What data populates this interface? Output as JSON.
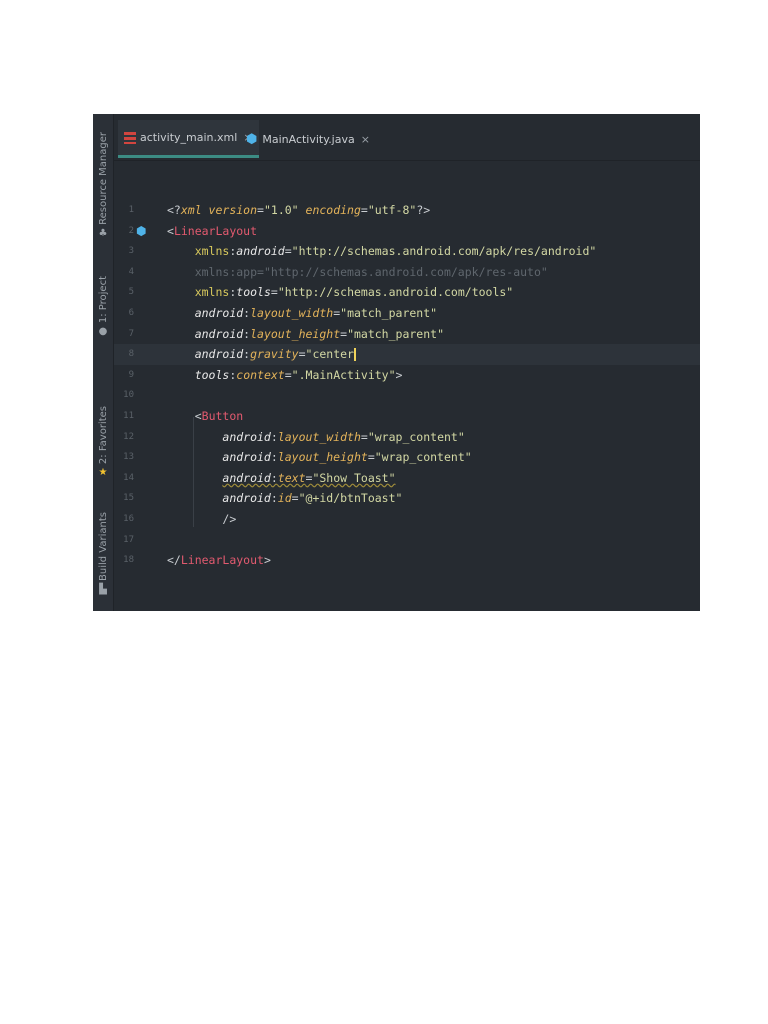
{
  "sidebar": {
    "items": [
      {
        "label": "Resource Manager",
        "icon": "resource-manager-icon"
      },
      {
        "label": "1: Project",
        "icon": "project-icon"
      },
      {
        "label": "2: Favorites",
        "icon": "star-icon"
      },
      {
        "label": "Build Variants",
        "icon": "build-variants-icon"
      }
    ]
  },
  "tabs": [
    {
      "label": "activity_main.xml",
      "close": "×",
      "icon": "xml-layout-icon"
    },
    {
      "label": "MainActivity.java",
      "close": "×",
      "icon": "java-class-icon"
    }
  ],
  "editor": {
    "current_line": 8,
    "lines": [
      {
        "n": "1",
        "tokens": [
          [
            "punct",
            "<?"
          ],
          [
            "decl",
            "xml version"
          ],
          [
            "punct",
            "="
          ],
          [
            "str",
            "\"1.0\" "
          ],
          [
            "decl",
            "encoding"
          ],
          [
            "punct",
            "="
          ],
          [
            "str",
            "\"utf-8\""
          ],
          [
            "punct",
            "?>"
          ]
        ]
      },
      {
        "n": "2",
        "tokens": [
          [
            "punct",
            "<"
          ],
          [
            "tag",
            "LinearLayout"
          ]
        ]
      },
      {
        "n": "3",
        "tokens": [
          [
            "pad",
            "    "
          ],
          [
            "xmlns",
            "xmlns"
          ],
          [
            "punct",
            ":"
          ],
          [
            "ns",
            "android"
          ],
          [
            "punct",
            "="
          ],
          [
            "str",
            "\"http://schemas.android.com/apk/res/android\""
          ]
        ]
      },
      {
        "n": "4",
        "tokens": [
          [
            "pad",
            "    "
          ],
          [
            "dim",
            "xmlns:app=\"http://schemas.android.com/apk/res-auto\""
          ]
        ]
      },
      {
        "n": "5",
        "tokens": [
          [
            "pad",
            "    "
          ],
          [
            "xmlns",
            "xmlns"
          ],
          [
            "punct",
            ":"
          ],
          [
            "ns",
            "tools"
          ],
          [
            "punct",
            "="
          ],
          [
            "str",
            "\"http://schemas.android.com/tools\""
          ]
        ]
      },
      {
        "n": "6",
        "tokens": [
          [
            "pad",
            "    "
          ],
          [
            "ns",
            "android"
          ],
          [
            "punct",
            ":"
          ],
          [
            "attr",
            "layout_width"
          ],
          [
            "punct",
            "="
          ],
          [
            "str",
            "\"match_parent\""
          ]
        ]
      },
      {
        "n": "7",
        "tokens": [
          [
            "pad",
            "    "
          ],
          [
            "ns",
            "android"
          ],
          [
            "punct",
            ":"
          ],
          [
            "attr",
            "layout_height"
          ],
          [
            "punct",
            "="
          ],
          [
            "str",
            "\"match_parent\""
          ]
        ]
      },
      {
        "n": "8",
        "tokens": [
          [
            "pad",
            "    "
          ],
          [
            "ns",
            "android"
          ],
          [
            "punct",
            ":"
          ],
          [
            "attr",
            "gravity"
          ],
          [
            "punct",
            "="
          ],
          [
            "str",
            "\"center"
          ],
          [
            "caret",
            ""
          ]
        ]
      },
      {
        "n": "9",
        "tokens": [
          [
            "pad",
            "    "
          ],
          [
            "ns",
            "tools"
          ],
          [
            "punct",
            ":"
          ],
          [
            "attr",
            "context"
          ],
          [
            "punct",
            "="
          ],
          [
            "str",
            "\".MainActivity\""
          ],
          [
            "punct",
            ">"
          ]
        ]
      },
      {
        "n": "10",
        "tokens": []
      },
      {
        "n": "11",
        "tokens": [
          [
            "pad",
            "    "
          ],
          [
            "punct",
            "<"
          ],
          [
            "tag",
            "Button"
          ]
        ]
      },
      {
        "n": "12",
        "tokens": [
          [
            "pad",
            "        "
          ],
          [
            "ns",
            "android"
          ],
          [
            "punct",
            ":"
          ],
          [
            "attr",
            "layout_width"
          ],
          [
            "punct",
            "="
          ],
          [
            "str",
            "\"wrap_content\""
          ]
        ]
      },
      {
        "n": "13",
        "tokens": [
          [
            "pad",
            "        "
          ],
          [
            "ns",
            "android"
          ],
          [
            "punct",
            ":"
          ],
          [
            "attr",
            "layout_height"
          ],
          [
            "punct",
            "="
          ],
          [
            "str",
            "\"wrap_content\""
          ]
        ]
      },
      {
        "n": "14",
        "tokens": [
          [
            "pad",
            "        "
          ],
          [
            "ns warn",
            "android"
          ],
          [
            "punct warn",
            ":"
          ],
          [
            "attr warn",
            "text"
          ],
          [
            "punct warn",
            "="
          ],
          [
            "str warn",
            "\"Show Toast\""
          ]
        ]
      },
      {
        "n": "15",
        "tokens": [
          [
            "pad",
            "        "
          ],
          [
            "ns",
            "android"
          ],
          [
            "punct",
            ":"
          ],
          [
            "attr",
            "id"
          ],
          [
            "punct",
            "="
          ],
          [
            "str",
            "\"@+id/btnToast\""
          ]
        ]
      },
      {
        "n": "16",
        "tokens": [
          [
            "pad",
            "        "
          ],
          [
            "punct",
            "/>"
          ]
        ]
      },
      {
        "n": "17",
        "tokens": []
      },
      {
        "n": "18",
        "tokens": [
          [
            "punct",
            "</"
          ],
          [
            "tag",
            "LinearLayout"
          ],
          [
            "punct",
            ">"
          ]
        ]
      }
    ]
  }
}
